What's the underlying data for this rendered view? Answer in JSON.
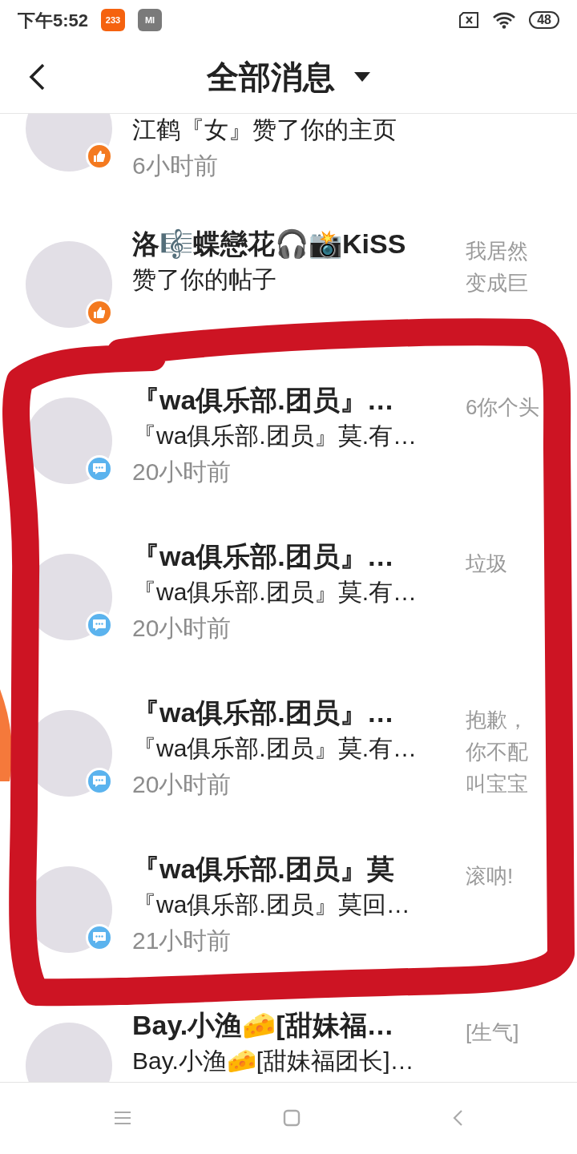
{
  "status_bar": {
    "time": "下午5:52",
    "app_icons": [
      {
        "kind": "game",
        "label": "233"
      },
      {
        "kind": "store",
        "label": "MI"
      }
    ],
    "battery": "48"
  },
  "header": {
    "title": "全部消息"
  },
  "messages": [
    {
      "kind": "like",
      "body": "江鹤『女』赞了你的主页",
      "time": "6小时前"
    },
    {
      "kind": "like",
      "title": "洛🎼蝶戀花🎧📸KiSS",
      "body": "赞了你的帖子",
      "preview": "我居然变成巨"
    },
    {
      "kind": "comment",
      "title": "『wa俱乐部.团员』…",
      "body": "『wa俱乐部.团员』莫.有…",
      "time": "20小时前",
      "preview": "6你个头"
    },
    {
      "kind": "comment",
      "title": "『wa俱乐部.团员』…",
      "body": "『wa俱乐部.团员』莫.有…",
      "time": "20小时前",
      "preview": "垃圾"
    },
    {
      "kind": "comment",
      "title": "『wa俱乐部.团员』…",
      "body": "『wa俱乐部.团员』莫.有…",
      "time": "20小时前",
      "preview": "抱歉，你不配叫宝宝"
    },
    {
      "kind": "comment",
      "title": "『wa俱乐部.团员』莫",
      "body": "『wa俱乐部.团员』莫回…",
      "time": "21小时前",
      "preview": "滚呐!"
    },
    {
      "title": "Bay.小渔🧀[甜妹福…",
      "body": "Bay.小渔🧀[甜妹福团长]…",
      "preview": "[生气]"
    }
  ]
}
